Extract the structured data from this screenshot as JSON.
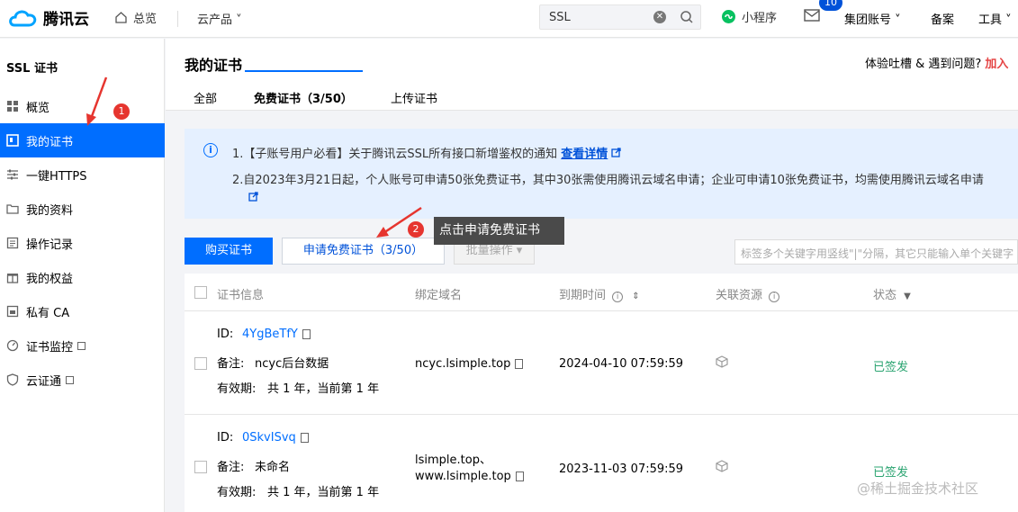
{
  "topbar": {
    "brand": "腾讯云",
    "home": "总览",
    "products": "云产品 ˅",
    "search_value": "SSL",
    "mini_program": "小程序",
    "mail_badge": "10",
    "account": "集团账号 ˅",
    "beian": "备案",
    "tools": "工具 ˅"
  },
  "sidebar": {
    "title": "SSL 证书",
    "items": [
      {
        "label": "概览"
      },
      {
        "label": "我的证书"
      },
      {
        "label": "一键HTTPS"
      },
      {
        "label": "我的资料"
      },
      {
        "label": "操作记录"
      },
      {
        "label": "我的权益"
      },
      {
        "label": "私有 CA"
      },
      {
        "label": "证书监控"
      },
      {
        "label": "云证通"
      }
    ]
  },
  "header": {
    "title": "我的证书",
    "feedback": "体验吐槽 & 遇到问题?",
    "feedback_link": "加入",
    "tabs": [
      "全部",
      "免费证书（3/50）",
      "上传证书"
    ]
  },
  "notice": {
    "line1": "1.【子账号用户必看】关于腾讯云SSL所有接口新增鉴权的通知 ",
    "line1_link": "查看详情",
    "line2": "2.自2023年3月21日起，个人账号可申请50张免费证书，其中30张需使用腾讯云域名申请；企业可申请10张免费证书，均需使用腾讯云域名申请"
  },
  "toolbar": {
    "buy": "购买证书",
    "apply": "申请免费证书（3/50）",
    "batch": "批量操作 ▾",
    "tag_placeholder": "标签多个关键字用竖线\"|\"分隔，其它只能输入单个关键字"
  },
  "annotations": {
    "step1": "1",
    "step2": "2",
    "tooltip": "点击申请免费证书"
  },
  "table": {
    "headers": [
      "证书信息",
      "绑定域名",
      "到期时间",
      "关联资源",
      "状态"
    ],
    "id_label": "ID:",
    "remark_label": "备注:",
    "validity_label": "有效期:",
    "rows": [
      {
        "id": "4YgBeTfY",
        "remark": "ncyc后台数据",
        "validity": "共 1 年，当前第 1 年",
        "domain": "ncyc.lsimple.top",
        "domain2": "",
        "expire": "2024-04-10 07:59:59",
        "status": "已签发"
      },
      {
        "id": "0SkvISvq",
        "remark": "未命名",
        "validity": "共 1 年，当前第 1 年",
        "domain": "lsimple.top、",
        "domain2": "www.lsimple.top",
        "expire": "2023-11-03 07:59:59",
        "status": "已签发"
      }
    ]
  },
  "watermark": "@稀土掘金技术社区",
  "colors": {
    "accent": "#006eff",
    "marker": "#e6352f",
    "success": "#2ba471"
  }
}
